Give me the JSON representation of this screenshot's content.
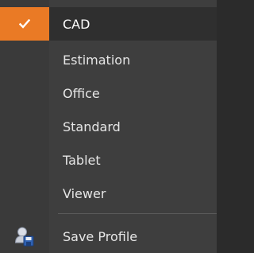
{
  "menu": {
    "items": [
      {
        "label": "CAD",
        "selected": true
      },
      {
        "label": "Estimation",
        "selected": false
      },
      {
        "label": "Office",
        "selected": false
      },
      {
        "label": "Standard",
        "selected": false
      },
      {
        "label": "Tablet",
        "selected": false
      },
      {
        "label": "Viewer",
        "selected": false
      }
    ],
    "save_profile_label": "Save Profile",
    "accent_color": "#ea7a25",
    "check_icon": "check-icon",
    "save_icon": "save-profile-icon"
  }
}
